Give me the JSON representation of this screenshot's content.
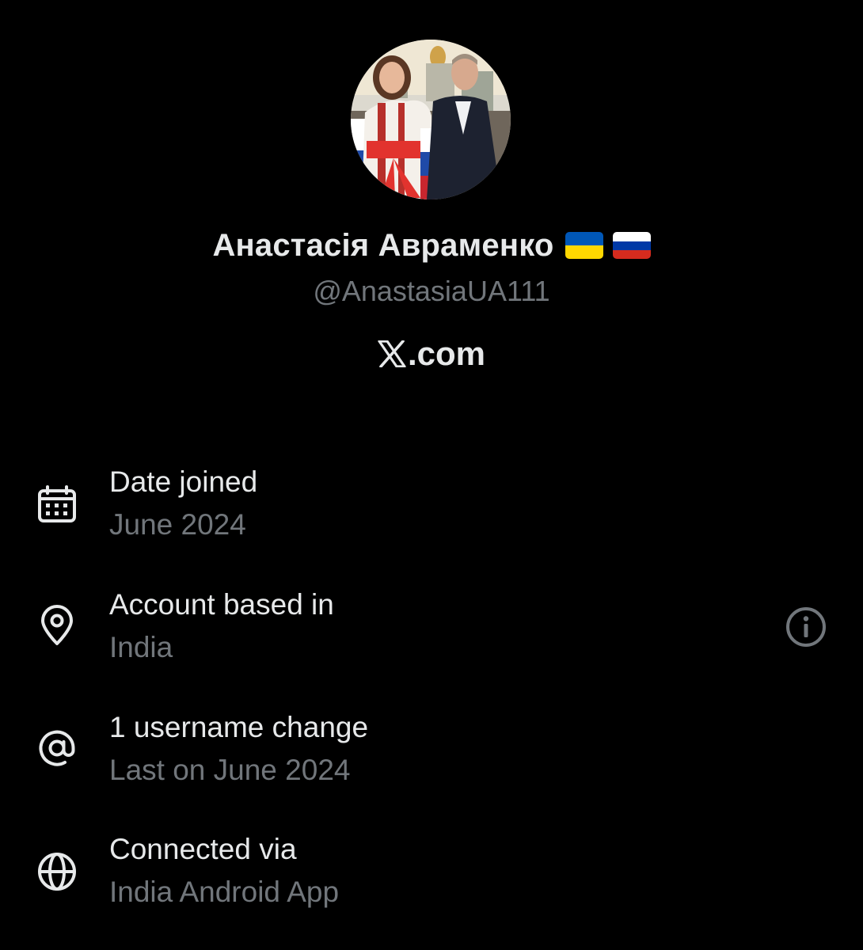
{
  "profile": {
    "display_name": "Анастасія Авраменко",
    "handle": "@AnastasiaUA111",
    "source_label": ".com",
    "flags": [
      "flag-ukraine-icon",
      "flag-russia-icon"
    ]
  },
  "about": {
    "rows": [
      {
        "title": "Date joined",
        "value": "June 2024",
        "icon": "calendar-icon"
      },
      {
        "title": "Account based in",
        "value": "India",
        "icon": "location-pin-icon",
        "action_icon": "info-icon"
      },
      {
        "title": "1 username change",
        "value": "Last on June 2024",
        "icon": "at-sign-icon"
      },
      {
        "title": "Connected via",
        "value": "India Android App",
        "icon": "globe-icon"
      }
    ]
  },
  "colors": {
    "background": "#000000",
    "primary_text": "#e7e9ea",
    "secondary_text": "#71767b",
    "ukraine_blue": "#0057b7",
    "ukraine_yellow": "#ffd700",
    "russia_white": "#ffffff",
    "russia_blue": "#0039a6",
    "russia_red": "#d52b1e"
  }
}
